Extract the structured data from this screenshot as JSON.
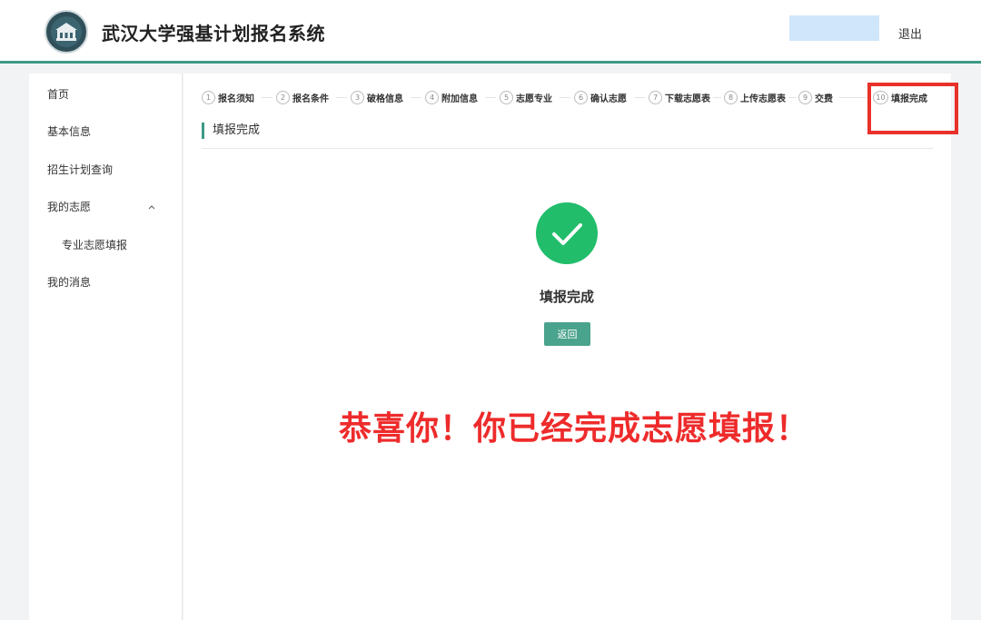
{
  "header": {
    "title": "武汉大学强基计划报名系统",
    "logout_label": "退出"
  },
  "sidebar": {
    "items": [
      {
        "label": "首页"
      },
      {
        "label": "基本信息"
      },
      {
        "label": "招生计划查询"
      },
      {
        "label": "我的志愿"
      },
      {
        "label": "专业志愿填报"
      },
      {
        "label": "我的消息"
      }
    ]
  },
  "steps": [
    {
      "num": "1",
      "label": "报名须知"
    },
    {
      "num": "2",
      "label": "报名条件"
    },
    {
      "num": "3",
      "label": "破格信息"
    },
    {
      "num": "4",
      "label": "附加信息"
    },
    {
      "num": "5",
      "label": "志愿专业"
    },
    {
      "num": "6",
      "label": "确认志愿"
    },
    {
      "num": "7",
      "label": "下载志愿表"
    },
    {
      "num": "8",
      "label": "上传志愿表"
    },
    {
      "num": "9",
      "label": "交费"
    },
    {
      "num": "10",
      "label": "填报完成"
    }
  ],
  "main": {
    "section_title": "填报完成",
    "done_text": "填报完成",
    "back_label": "返回",
    "congrats": "恭喜你！你已经完成志愿填报！"
  },
  "colors": {
    "accent": "#3e9a86",
    "success": "#21bd6b",
    "annotation": "#e8312a"
  }
}
